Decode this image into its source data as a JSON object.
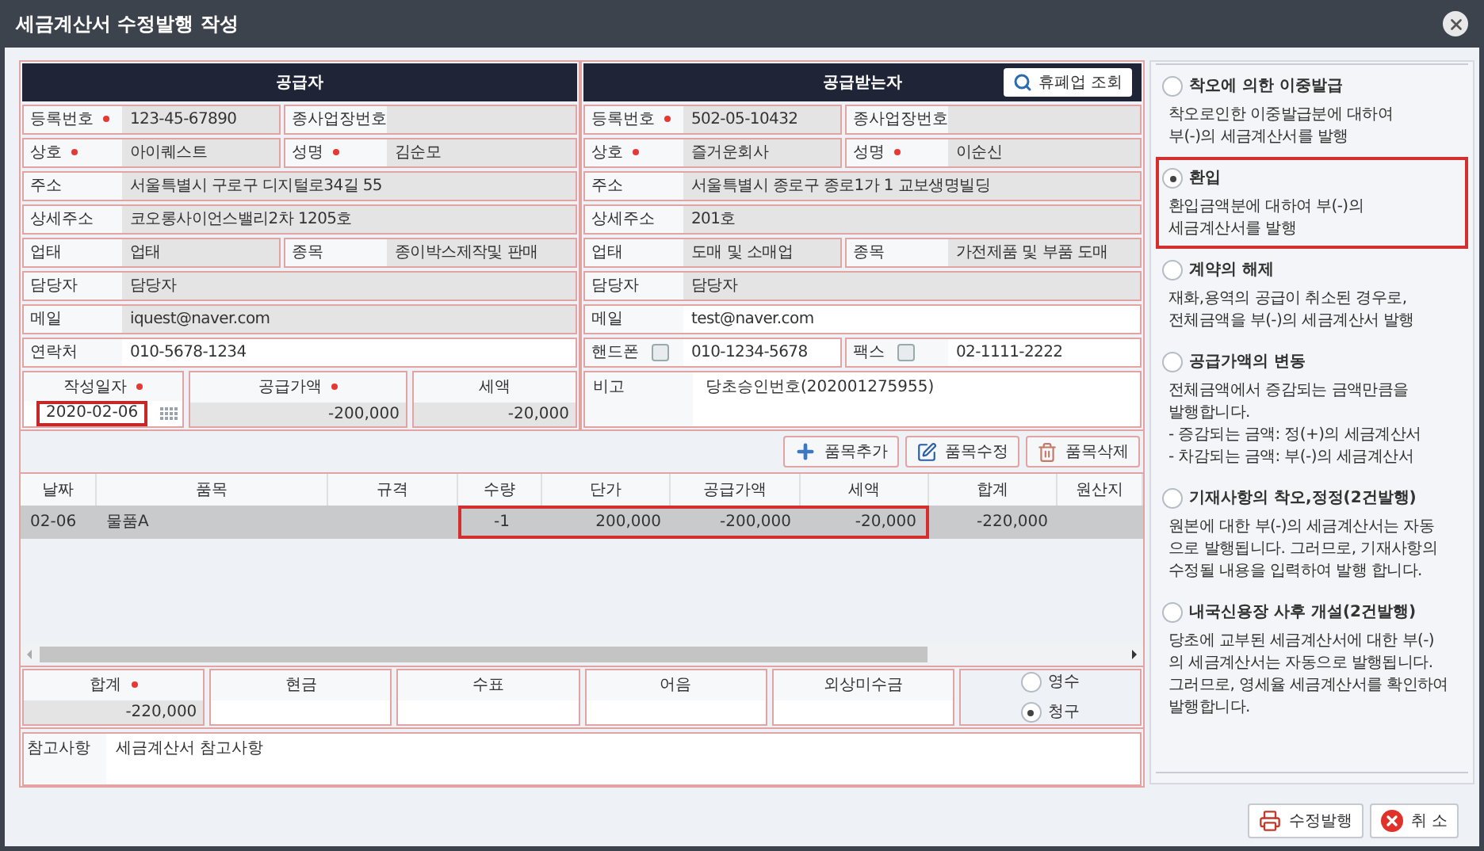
{
  "window": {
    "title": "세금계산서 수정발행 작성"
  },
  "supplier": {
    "title": "공급자",
    "rows": [
      [
        {
          "label": "등록번호",
          "required": true,
          "value": "123-45-67890",
          "editable": false
        },
        {
          "label": "종사업장번호",
          "required": false,
          "editable": false
        }
      ],
      [
        {
          "label": "상호",
          "required": true,
          "value": "아이퀘스트",
          "editable": false
        },
        {
          "label": "성명",
          "required": true,
          "value": "김순모",
          "editable": false
        }
      ],
      [
        {
          "label": "주소",
          "required": false,
          "value": "서울특별시 구로구 디지털로34길 55",
          "editable": false
        }
      ],
      [
        {
          "label": "상세주소",
          "required": false,
          "value": "코오롱사이언스밸리2차 1205호",
          "editable": false
        }
      ],
      [
        {
          "label": "업태",
          "required": false,
          "value": "업태",
          "editable": false
        },
        {
          "label": "종목",
          "required": false,
          "value": "종이박스제작및 판매",
          "editable": false
        }
      ],
      [
        {
          "label": "담당자",
          "required": false,
          "value": "담당자",
          "editable": false
        }
      ],
      [
        {
          "label": "메일",
          "required": false,
          "value": "iquest@naver.com",
          "editable": false
        }
      ],
      [
        {
          "label": "연락처",
          "required": false,
          "value": "010-5678-1234",
          "editable": true
        }
      ]
    ],
    "summary": [
      {
        "label": "작성일자",
        "required": true,
        "value": "2020-02-06",
        "kind": "date"
      },
      {
        "label": "공급가액",
        "required": true,
        "value": "-200,000",
        "kind": "amount"
      },
      {
        "label": "세액",
        "required": false,
        "value": "-20,000",
        "kind": "amount"
      }
    ]
  },
  "buyer": {
    "title": "공급받는자",
    "lookup_button": "휴폐업 조회",
    "rows": [
      [
        {
          "label": "등록번호",
          "required": true,
          "value": "502-05-10432",
          "editable": false
        },
        {
          "label": "종사업장번호",
          "required": false,
          "editable": false
        }
      ],
      [
        {
          "label": "상호",
          "required": true,
          "value": "즐거운회사",
          "editable": false
        },
        {
          "label": "성명",
          "required": true,
          "value": "이순신",
          "editable": false
        }
      ],
      [
        {
          "label": "주소",
          "required": false,
          "value": "서울특별시 종로구 종로1가 1 교보생명빌딩",
          "editable": false
        }
      ],
      [
        {
          "label": "상세주소",
          "required": false,
          "value": "201호",
          "editable": false
        }
      ],
      [
        {
          "label": "업태",
          "required": false,
          "value": "도매 및 소매업",
          "editable": false
        },
        {
          "label": "종목",
          "required": false,
          "value": "가전제품 및 부품 도매",
          "editable": false
        }
      ],
      [
        {
          "label": "담당자",
          "required": false,
          "value": "담당자",
          "editable": false
        }
      ],
      [
        {
          "label": "메일",
          "required": false,
          "value": "test@naver.com",
          "editable": true
        }
      ],
      [
        {
          "label": "핸드폰",
          "required": false,
          "checked": false,
          "value": "010-1234-5678",
          "editable": true
        },
        {
          "label": "팩스",
          "required": false,
          "checked": false,
          "value": "02-1111-2222",
          "editable": true
        }
      ]
    ],
    "note": {
      "label": "비고",
      "value": "당초승인번호(202001275955)"
    }
  },
  "item_buttons": [
    {
      "label": "품목추가",
      "kind": "add"
    },
    {
      "label": "품목수정",
      "kind": "edit"
    },
    {
      "label": "품목삭제",
      "kind": "delete"
    }
  ],
  "table": {
    "columns": [
      "날짜",
      "품목",
      "규격",
      "수량",
      "단가",
      "공급가액",
      "세액",
      "합계",
      "원산지"
    ],
    "rows": [
      {
        "selected": true,
        "cells": [
          {
            "text": "02-06",
            "highlighted": false
          },
          {
            "text": "물품A",
            "highlighted": false
          },
          {
            "highlighted": false
          },
          {
            "text": "-1",
            "highlighted": true
          },
          {
            "text": "200,000",
            "highlighted": true
          },
          {
            "text": "-200,000",
            "highlighted": true
          },
          {
            "text": "-20,000",
            "highlighted": true
          },
          {
            "text": "-220,000",
            "highlighted": false
          },
          {
            "highlighted": false
          }
        ]
      }
    ]
  },
  "totals": [
    {
      "label": "합계",
      "required": true,
      "value": "-220,000"
    },
    {
      "label": "현금",
      "required": false
    },
    {
      "label": "수표",
      "required": false
    },
    {
      "label": "어음",
      "required": false
    },
    {
      "label": "외상미수금",
      "required": false
    }
  ],
  "receipt_type": [
    {
      "label": "영수",
      "selected": false
    },
    {
      "label": "청구",
      "selected": true
    }
  ],
  "remarks": {
    "label": "참고사항",
    "value": "세금계산서 참고사항"
  },
  "options": [
    {
      "title": "착오에 의한 이중발급",
      "description": "착오로인한 이중발급분에 대하여\n부(-)의 세금계산서를 발행",
      "selected": false
    },
    {
      "title": "환입",
      "description": "환입금액분에 대하여 부(-)의\n세금계산서를 발행",
      "selected": true
    },
    {
      "title": "계약의 해제",
      "description": "재화,용역의 공급이 취소된 경우로,\n전체금액을 부(-)의 세금계산서 발행",
      "selected": false
    },
    {
      "title": "공급가액의 변동",
      "description": "전체금액에서 증감되는 금액만큼을\n발행합니다.\n- 증감되는 금액: 정(+)의 세금계산서\n- 차감되는 금액: 부(-)의 세금계산서",
      "selected": false
    },
    {
      "title": "기재사항의 착오,정정(2건발행)",
      "description": "원본에 대한 부(-)의 세금계산서는 자동\n으로 발행됩니다. 그러므로, 기재사항의\n수정될 내용을 입력하여 발행 합니다.",
      "selected": false
    },
    {
      "title": "내국신용장 사후 개설(2건발행)",
      "description": "당초에 교부된 세금계산서에 대한 부(-)\n의 세금계산서는 자동으로 발행됩니다.\n그러므로, 영세율 세금계산서를 확인하여\n발행합니다.",
      "selected": false
    }
  ],
  "footer_buttons": [
    {
      "label": "수정발행",
      "kind": "issue"
    },
    {
      "label": "취 소",
      "kind": "cancel"
    }
  ]
}
